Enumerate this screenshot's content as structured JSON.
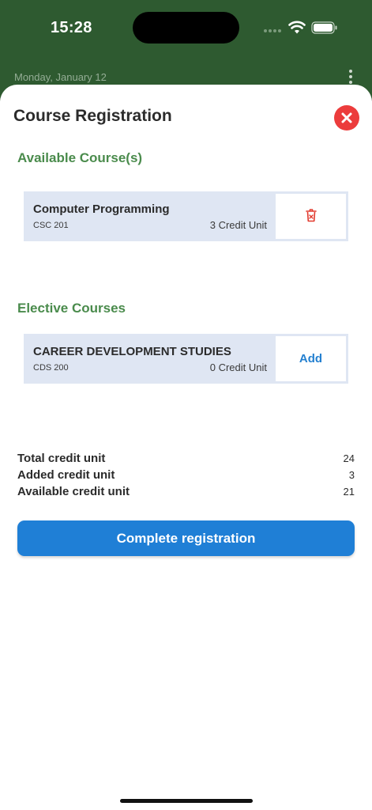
{
  "status_bar": {
    "time": "15:28",
    "icons": [
      "signal-icon",
      "wifi-icon",
      "battery-icon"
    ]
  },
  "header": {
    "date": "Monday, January 12",
    "menu_icon": "more-vertical-icon"
  },
  "sheet": {
    "title": "Course Registration",
    "close_icon": "close-icon"
  },
  "available": {
    "title": "Available Course(s)",
    "courses": [
      {
        "name": "Computer Programming",
        "code": "CSC 201",
        "credit": "3 Credit Unit",
        "action_icon": "delete-icon"
      }
    ]
  },
  "elective": {
    "title": "Elective Courses",
    "courses": [
      {
        "name": "CAREER DEVELOPMENT STUDIES",
        "code": "CDS 200",
        "credit": "0 Credit Unit",
        "action_label": "Add"
      }
    ]
  },
  "summary": {
    "rows": [
      {
        "label": "Total credit unit",
        "value": "24"
      },
      {
        "label": "Added credit unit",
        "value": "3"
      },
      {
        "label": "Available credit unit",
        "value": "21"
      }
    ]
  },
  "actions": {
    "complete_label": "Complete registration"
  },
  "colors": {
    "header_bg": "#2e5a30",
    "section_title": "#4a8b4c",
    "card_bg": "#dfe6f3",
    "primary": "#1f7fd6",
    "danger": "#ec3c3c"
  }
}
